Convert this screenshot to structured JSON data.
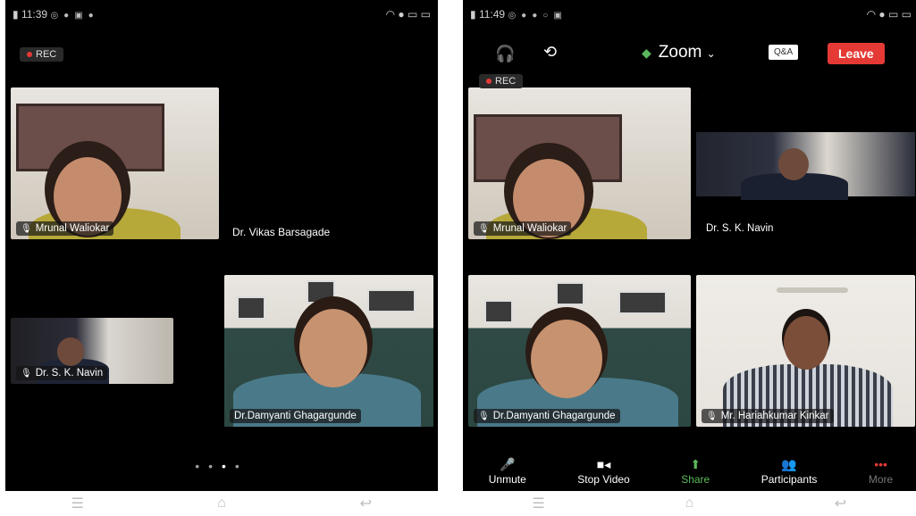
{
  "left_phone": {
    "status_time": "11:39",
    "rec_label": "REC",
    "tiles": [
      {
        "name": "Mrunal Waliokar"
      },
      {
        "name": "Dr. Vikas Barsagade"
      },
      {
        "name": "Dr. S. K. Navin"
      },
      {
        "name": "Dr.Damyanti Ghagargunde"
      }
    ],
    "page_dots": [
      "•",
      "•",
      "•",
      "•"
    ]
  },
  "right_phone": {
    "status_time": "11:49",
    "rec_label": "REC",
    "app_title": "Zoom",
    "qa_label": "Q&A",
    "leave_label": "Leave",
    "tiles": [
      {
        "name": "Mrunal Waliokar"
      },
      {
        "name": "Dr. S. K. Navin"
      },
      {
        "name": "Dr.Damyanti Ghagargunde"
      },
      {
        "name": "Mr. Hariahkumar Kinkar"
      }
    ],
    "toolbar": [
      {
        "label": "Unmute",
        "icon": "mic-off-icon"
      },
      {
        "label": "Stop Video",
        "icon": "video-icon"
      },
      {
        "label": "Share",
        "icon": "share-icon"
      },
      {
        "label": "Participants",
        "icon": "participants-icon"
      },
      {
        "label": "More",
        "icon": "more-icon"
      }
    ]
  },
  "colors": {
    "active_border": "#5cb85c",
    "leave": "#e53935",
    "background": "#000000"
  }
}
